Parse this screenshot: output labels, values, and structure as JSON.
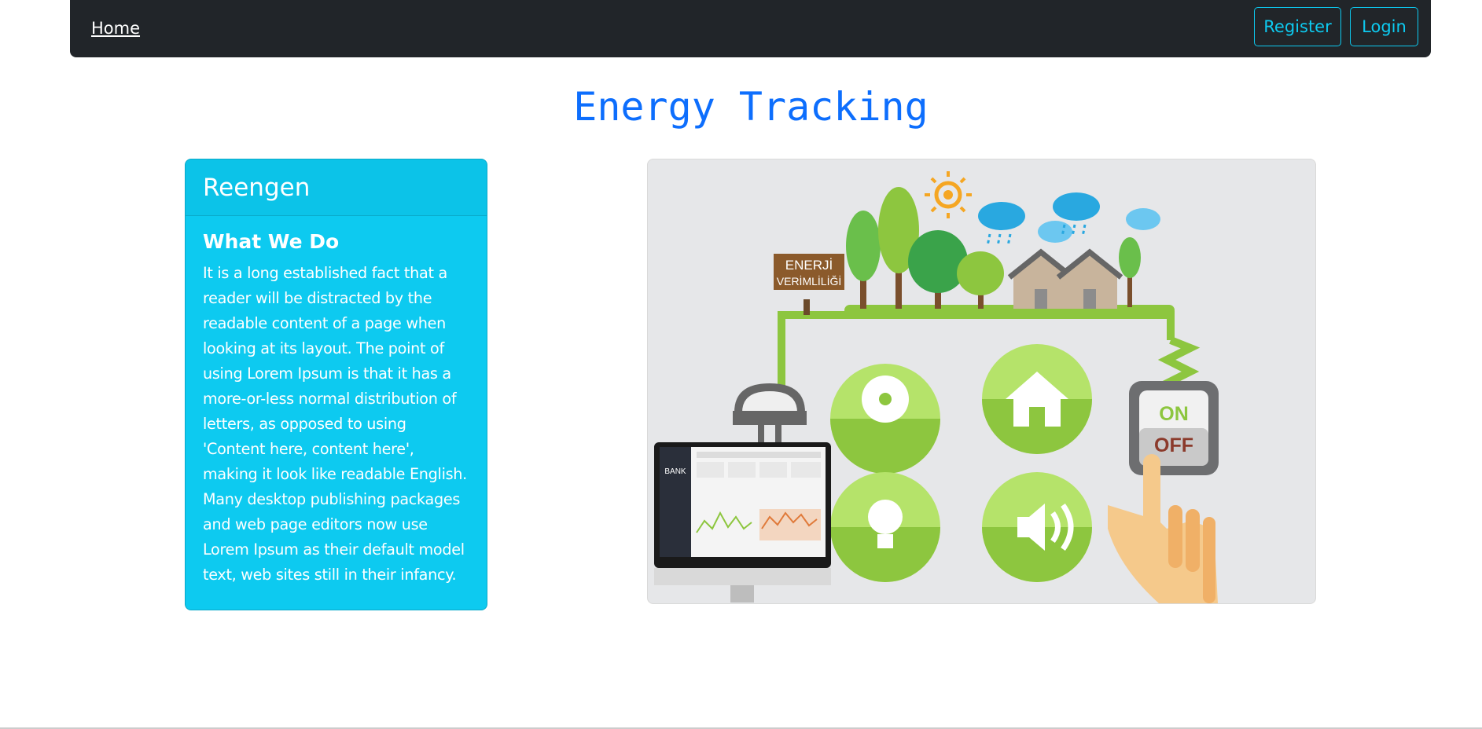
{
  "nav": {
    "home_label": "Home",
    "register_label": "Register",
    "login_label": "Login"
  },
  "page": {
    "title": "Energy Tracking"
  },
  "card": {
    "header": "Reengen",
    "title": "What We Do",
    "text": "It is a long established fact that a reader will be distracted by the readable content of a page when looking at its layout. The point of using Lorem Ipsum is that it has a more-or-less normal distribution of letters, as opposed to using 'Content here, content here', making it look like readable English. Many desktop publishing packages and web page editors now use Lorem Ipsum as their default model text, web sites still in their infancy."
  },
  "illustration": {
    "sign_line1": "ENERJİ",
    "sign_line2": "VERİMLİLİĞİ",
    "switch_on": "ON",
    "switch_off": "OFF",
    "monitor_brand": "BANK"
  },
  "colors": {
    "navbar": "#212529",
    "accent_info": "#0dcaf0",
    "title_blue": "#0d6efd",
    "green": "#8dc63f"
  }
}
